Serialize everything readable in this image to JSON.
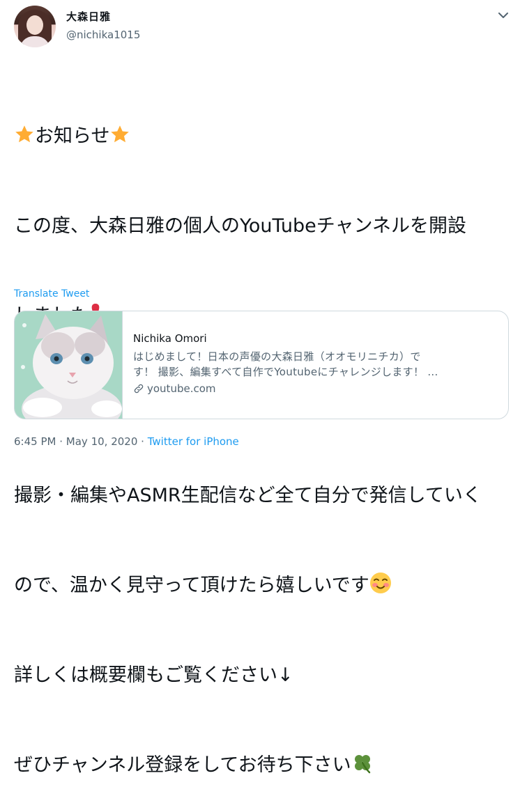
{
  "user": {
    "display_name": "大森日雅",
    "handle": "@nichika1015"
  },
  "menu": {
    "icon": "chevron-down-icon"
  },
  "tweet": {
    "lines": [
      {
        "pre_emoji": "star",
        "text": "お知らせ",
        "post_emoji": "star"
      },
      {
        "text": "この度、大森日雅の個人のYouTubeチャンネルを開設"
      },
      {
        "text": "しました",
        "post_emoji": "exclamation"
      },
      {
        "text": ""
      },
      {
        "text": "撮影・編集やASMR生配信など全て自分で発信していく"
      },
      {
        "text": "ので、温かく見守って頂けたら嬉しいです",
        "post_emoji": "smile"
      },
      {
        "text": "詳しくは概要欄もご覧ください↓"
      },
      {
        "text": "ぜひチャンネル登録をしてお待ち下さい",
        "post_emoji": "clover"
      }
    ]
  },
  "translate_label": "Translate Tweet",
  "card": {
    "title": "Nichika Omori",
    "description_line1": "はじめまして！日本の声優の大森日雅（オオモリニチカ）で",
    "description_line2": "す！ 撮影、編集すべて自作でYoutubeにチャレンジします！ ...",
    "link": "youtube.com",
    "thumbnail_subject": "white cat"
  },
  "meta": {
    "time": "6:45 PM",
    "separator": "·",
    "date": "May 10, 2020",
    "source": "Twitter for iPhone"
  },
  "colors": {
    "link_blue": "#1d9bf0",
    "secondary_text": "#536471",
    "border": "#cfd9de"
  }
}
